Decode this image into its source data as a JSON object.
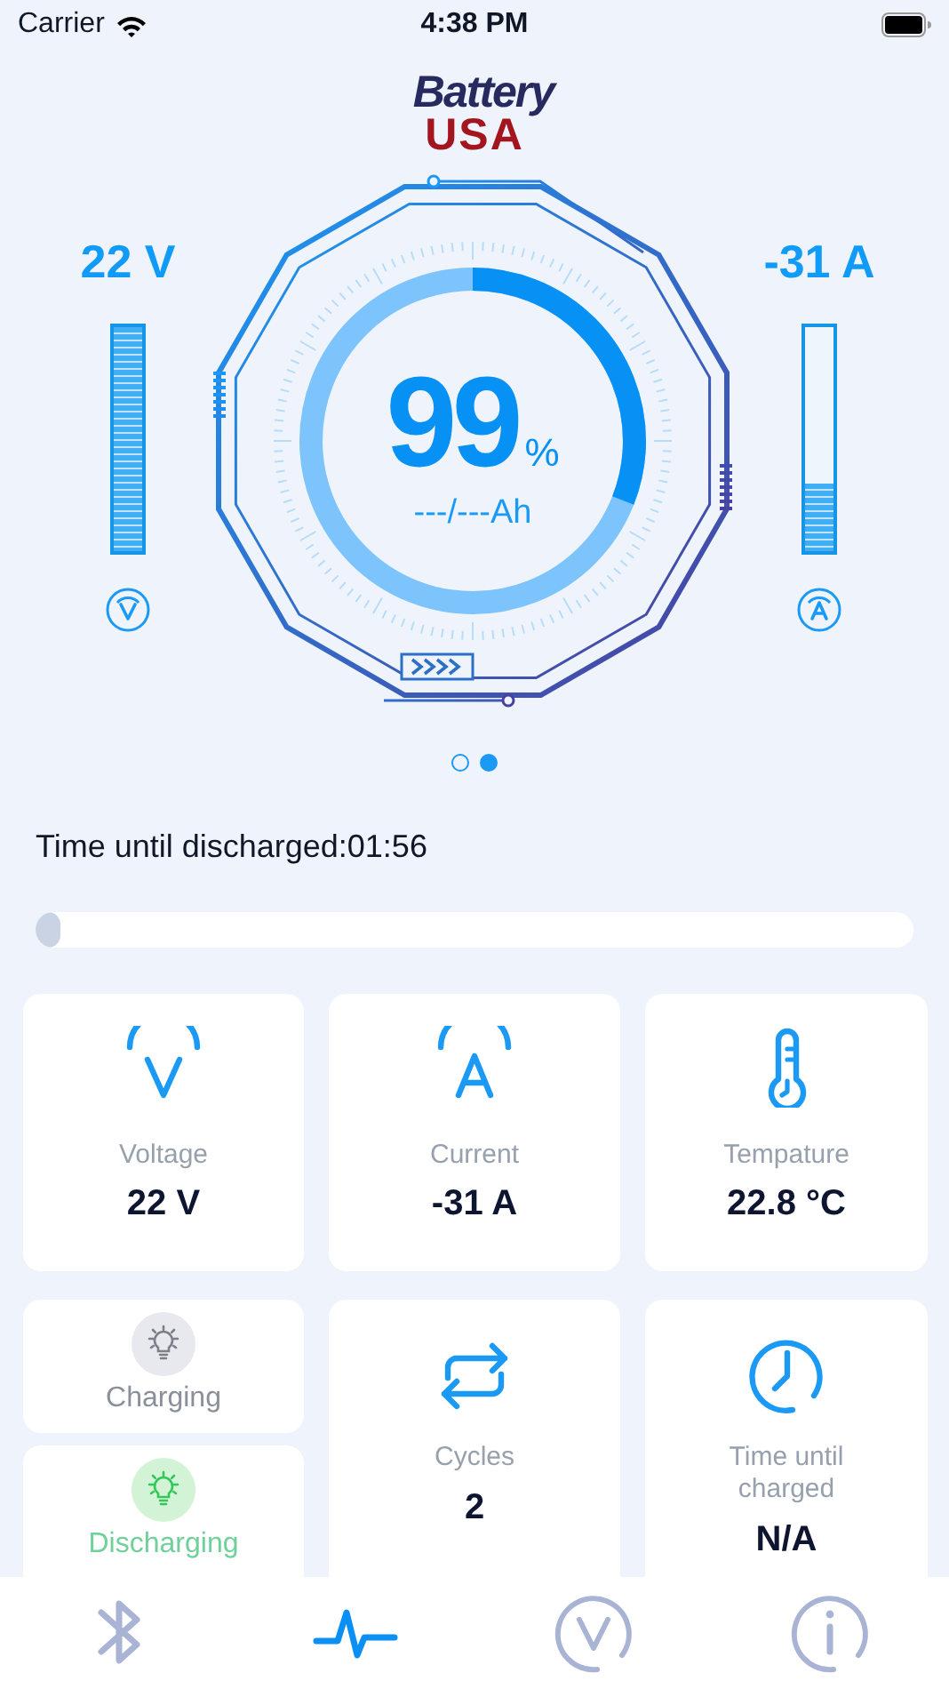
{
  "status_bar": {
    "carrier": "Carrier",
    "time": "4:38 PM"
  },
  "logo": {
    "line_1": "Battery",
    "line_2": "USA"
  },
  "gauge": {
    "percent": "99",
    "unit": "%",
    "capacity": "---/---Ah",
    "level": 0.31,
    "voltage": {
      "reading": "22 V",
      "level": 1.0
    },
    "current": {
      "reading": "-31 A",
      "level": 0.3
    }
  },
  "pages": [
    {
      "selected": false
    },
    {
      "selected": true
    }
  ],
  "discharge": {
    "label": "Time until discharged:01:56",
    "level": 0.02
  },
  "metrics": [
    {
      "kind": "voltage",
      "label": "Voltage",
      "value": "22 V"
    },
    {
      "kind": "current",
      "label": "Current",
      "value": "-31 A"
    },
    {
      "kind": "temperature",
      "label": "Tempature",
      "value": "22.8 °C"
    }
  ],
  "states": [
    {
      "label": "Charging",
      "on": false
    },
    {
      "label": "Discharging",
      "on": true
    }
  ],
  "counters": [
    {
      "kind": "cycles",
      "label": "Cycles",
      "value": "2"
    },
    {
      "kind": "clock",
      "label": "Time until charged",
      "value": "N/A"
    }
  ],
  "tabs": [
    {
      "kind": "bluetooth",
      "selected": false
    },
    {
      "kind": "pulse",
      "selected": true
    },
    {
      "kind": "voltage",
      "selected": false
    },
    {
      "kind": "info",
      "selected": false
    }
  ]
}
